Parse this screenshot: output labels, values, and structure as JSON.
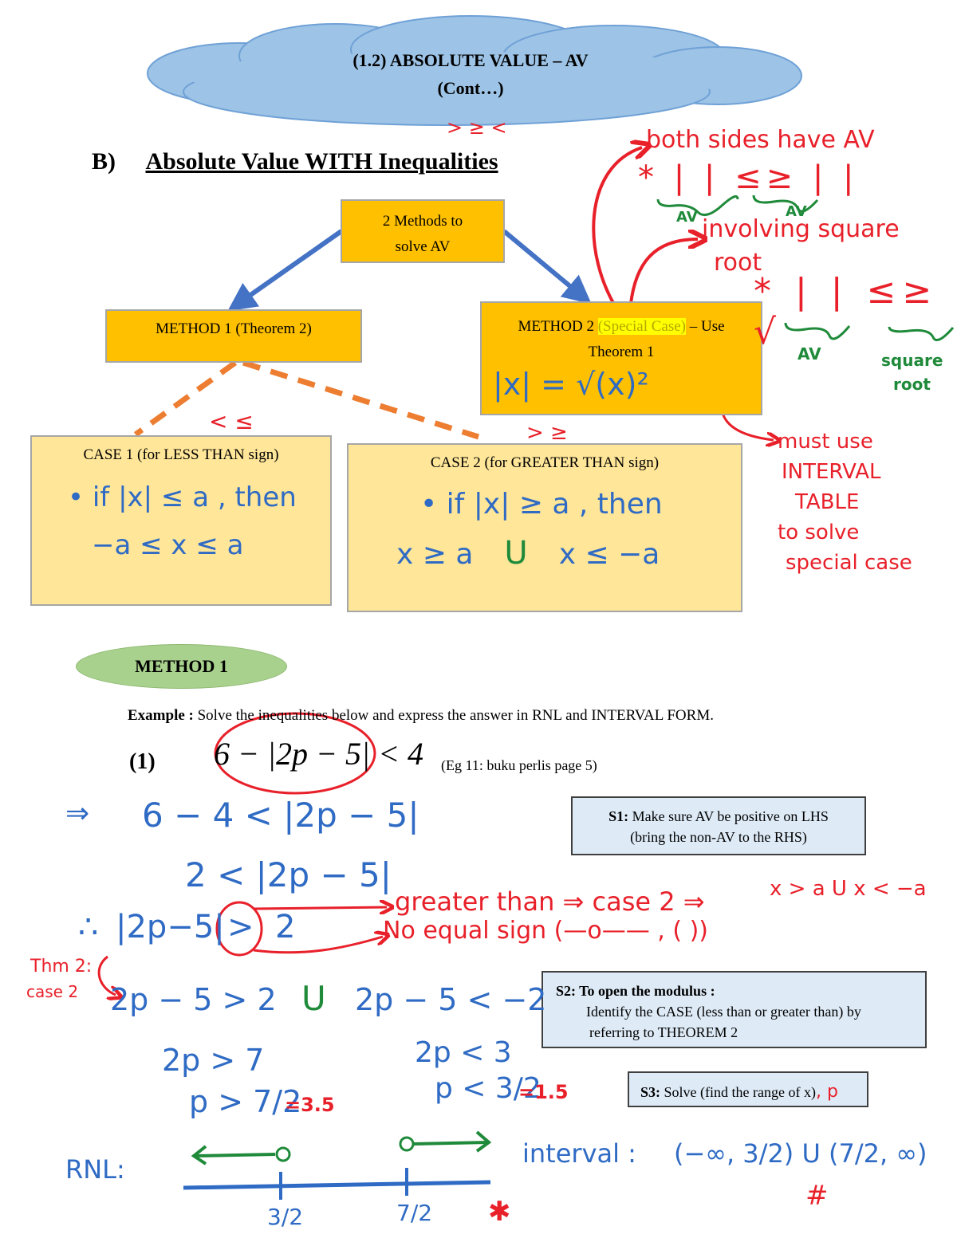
{
  "header": {
    "title_line1": "(1.2) ABSOLUTE VALUE – AV",
    "title_line2": "(Cont…)",
    "annotation_signs": "> ≥ <",
    "section_label": "B)",
    "section_title": "Absolute Value WITH Inequalities"
  },
  "flowchart": {
    "root": {
      "line1": "2 Methods to",
      "line2": "solve AV"
    },
    "method1": {
      "label": "METHOD 1 (Theorem 2)"
    },
    "method2": {
      "prefix": "METHOD 2 ",
      "highlight": "(Special Case)",
      "suffix": " – Use",
      "line2": "Theorem 1",
      "formula": "|x| = √(x)²"
    },
    "case1": {
      "title": "CASE 1 (for LESS THAN sign)",
      "above_signs": "< ≤",
      "line1": "• if |x| ≤ a , then",
      "line2": "−a ≤ x ≤ a"
    },
    "case2": {
      "title": "CASE 2 (for GREATER THAN sign)",
      "above_signs": "> ≥",
      "line1": "• if |x| ≥ a , then",
      "line2_left": "x ≥ a",
      "union": "U",
      "line2_right": "x ≤ −a"
    }
  },
  "side_notes": {
    "both_sides": "both sides have AV",
    "both_sides_expr": "* |  | ≤≥ |  |",
    "brace_label_left": "AV",
    "brace_label_right": "AV",
    "involving": "involving square",
    "involving_2": "root",
    "sqrt_expr": "* |  | ≤≥ √",
    "brace_av": "AV",
    "brace_sq_1": "square",
    "brace_sq_2": "root",
    "must_use_1": "must use",
    "must_use_2": "INTERVAL",
    "must_use_3": "TABLE",
    "must_use_4": "to solve",
    "must_use_5": "special case"
  },
  "method1_section": {
    "badge": "METHOD 1",
    "example_label": "Example :",
    "example_text": " Solve the inequalities below and express the answer in RNL and INTERVAL FORM.",
    "problem_number": "(1)",
    "problem_expr": "6 − |2p − 5| < 4",
    "reference": "(Eg 11: buku perlis page 5)"
  },
  "steps": {
    "s1_label": "S1:",
    "s1_line1": " Make sure AV be positive on LHS",
    "s1_line2": "(bring the non-AV to the RHS)",
    "s2_label": "S2: To open the modulus :",
    "s2_line1": "Identify the CASE (less than or greater than) by",
    "s2_line2": "referring to THEOREM 2",
    "s3_label": "S3:",
    "s3_text": " Solve (find the range of x)",
    "s3_annot": ", p"
  },
  "working": {
    "arrow": "⇒",
    "line1": "6 − 4 < |2p − 5|",
    "line2": "2 < |2p − 5|",
    "line3_prefix": "∴",
    "line3": "|2p−5|",
    "line3_sign": ">",
    "line3_val": "2",
    "note_greater": "greater than ⇒ case 2 ⇒",
    "note_case": "x > a U x < −a",
    "note_no_equal": "No equal sign (—o——  , (   ))",
    "thm_note_1": "Thm 2:",
    "thm_note_2": "case 2",
    "split_left": "2p − 5 > 2",
    "split_union": "U",
    "split_right": "2p − 5 < −2",
    "left_step1": "2p > 7",
    "left_step2": "p > 7/2",
    "left_decimal": "=3.5",
    "right_step1": "2p < 3",
    "right_step2": "p < 3/2",
    "right_decimal": "=1.5"
  },
  "rnl": {
    "label": "RNL:",
    "tick1": "3/2",
    "tick2": "7/2",
    "star": "✱",
    "interval_label": "interval :",
    "interval_value": "(−∞, 3/2) U (7/2, ∞)",
    "interval_star": "#"
  },
  "colors": {
    "orange_box": "#ffc000",
    "yellow_box": "#ffe699",
    "blue_box": "#deebf7",
    "cloud": "#9dc3e6",
    "ink_blue": "#2f6bc4",
    "ink_red": "#e8202a",
    "ink_green": "#1f8a3a",
    "dash_orange": "#ed7d31",
    "ellipse_green": "#a9d18e"
  }
}
